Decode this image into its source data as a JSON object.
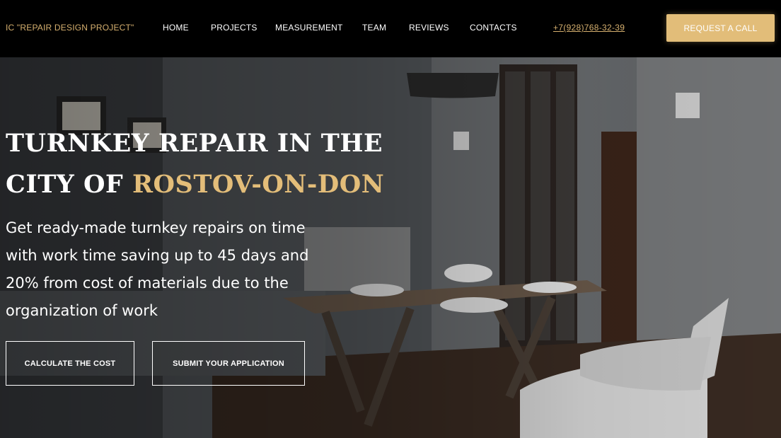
{
  "header": {
    "logo": "IC \"REPAIR DESIGN PROJECT\"",
    "nav": [
      {
        "label": "HOME"
      },
      {
        "label": "PROJECTS"
      },
      {
        "label": "MEASUREMENT"
      },
      {
        "label": "TEAM"
      },
      {
        "label": "REVIEWS"
      },
      {
        "label": "CONTACTS"
      }
    ],
    "phone": "+7(928)768-32-39",
    "request_button": "REQUEST A CALL"
  },
  "hero": {
    "title_part1": "TURNKEY REPAIR IN THE CITY OF ",
    "title_accent": "ROSTOV-ON-DON",
    "subtitle": "Get ready-made turnkey repairs on time with work time saving up to 45 days and 20% from cost of materials due to the organization of work",
    "calc_button": "CALCULATE THE COST",
    "submit_button": "SUBMIT YOUR APPLICATION"
  },
  "colors": {
    "accent": "#e2bd79",
    "header_bg": "#000000",
    "text_light": "#ffffff"
  }
}
